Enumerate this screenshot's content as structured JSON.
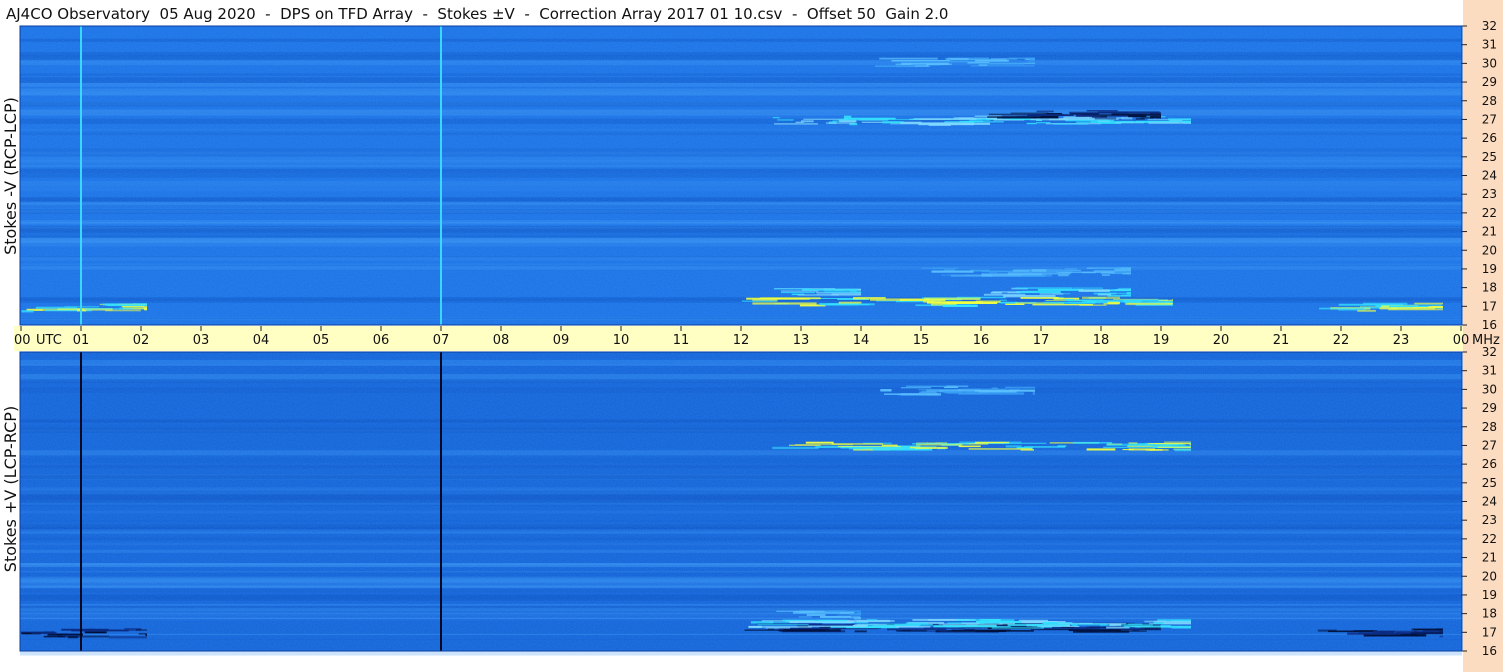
{
  "title": "AJ4CO Observatory  05 Aug 2020  -  DPS on TFD Array  -  Stokes ±V  -  Correction Array 2017 01 10.csv  -  Offset 50  Gain 2.0",
  "colors": {
    "page_bg": "#ffffff",
    "time_strip": "#ffffc4",
    "freq_strip": "#fcdcc0",
    "spec_base_top": "#1f74e6",
    "spec_base_bottom": "#1866da",
    "burst_cyan": "#33e0ff",
    "burst_yellow": "#f0ff40",
    "dark_line": "#00103a"
  },
  "chart_data": [
    {
      "type": "heatmap",
      "name": "Stokes -V (RCP-LCP)",
      "ylabel": "Stokes -V (RCP-LCP)",
      "xlabel_units": "UTC",
      "yunits": "MHz",
      "xlim": [
        0,
        24
      ],
      "ylim": [
        16,
        32
      ],
      "x_ticks": [
        "00",
        "01",
        "02",
        "03",
        "04",
        "05",
        "06",
        "07",
        "08",
        "09",
        "10",
        "11",
        "12",
        "13",
        "14",
        "15",
        "16",
        "17",
        "18",
        "19",
        "20",
        "21",
        "22",
        "23",
        "00"
      ],
      "y_ticks": [
        "16",
        "17",
        "18",
        "19",
        "20",
        "21",
        "22",
        "23",
        "24",
        "25",
        "26",
        "27",
        "28",
        "29",
        "30",
        "31",
        "32"
      ],
      "vertical_markers_utc": [
        1.0,
        7.0
      ],
      "marker_color": "cyan",
      "activity": [
        {
          "start_utc": 0.0,
          "end_utc": 2.1,
          "freq_mhz": 17.0,
          "intensity": "high"
        },
        {
          "start_utc": 12.0,
          "end_utc": 19.2,
          "freq_mhz": 17.3,
          "intensity": "high"
        },
        {
          "start_utc": 12.5,
          "end_utc": 14.0,
          "freq_mhz": 17.8,
          "intensity": "medium"
        },
        {
          "start_utc": 16.0,
          "end_utc": 18.5,
          "freq_mhz": 17.8,
          "intensity": "medium"
        },
        {
          "start_utc": 21.5,
          "end_utc": 23.7,
          "freq_mhz": 17.0,
          "intensity": "high"
        },
        {
          "start_utc": 15.0,
          "end_utc": 18.5,
          "freq_mhz": 18.9,
          "intensity": "low"
        },
        {
          "start_utc": 12.5,
          "end_utc": 19.5,
          "freq_mhz": 27.0,
          "intensity": "medium"
        },
        {
          "start_utc": 14.2,
          "end_utc": 16.9,
          "freq_mhz": 30.1,
          "intensity": "low"
        },
        {
          "start_utc": 16.0,
          "end_utc": 19.0,
          "freq_mhz": 27.3,
          "intensity": "dark"
        }
      ]
    },
    {
      "type": "heatmap",
      "name": "Stokes +V (LCP-RCP)",
      "ylabel": "Stokes +V (LCP-RCP)",
      "xlabel_units": "UTC",
      "yunits": "MHz",
      "xlim": [
        0,
        24
      ],
      "ylim": [
        16,
        32
      ],
      "x_ticks": [
        "00",
        "01",
        "02",
        "03",
        "04",
        "05",
        "06",
        "07",
        "08",
        "09",
        "10",
        "11",
        "12",
        "13",
        "14",
        "15",
        "16",
        "17",
        "18",
        "19",
        "20",
        "21",
        "22",
        "23",
        "00"
      ],
      "y_ticks": [
        "16",
        "17",
        "18",
        "19",
        "20",
        "21",
        "22",
        "23",
        "24",
        "25",
        "26",
        "27",
        "28",
        "29",
        "30",
        "31",
        "32"
      ],
      "vertical_markers_utc": [
        1.0,
        7.0
      ],
      "marker_color": "black",
      "activity": [
        {
          "start_utc": 0.0,
          "end_utc": 2.1,
          "freq_mhz": 17.0,
          "intensity": "dark"
        },
        {
          "start_utc": 12.0,
          "end_utc": 19.0,
          "freq_mhz": 17.3,
          "intensity": "dark"
        },
        {
          "start_utc": 12.0,
          "end_utc": 19.5,
          "freq_mhz": 17.5,
          "intensity": "medium"
        },
        {
          "start_utc": 21.5,
          "end_utc": 23.7,
          "freq_mhz": 17.0,
          "intensity": "dark"
        },
        {
          "start_utc": 12.5,
          "end_utc": 19.5,
          "freq_mhz": 27.0,
          "intensity": "high"
        },
        {
          "start_utc": 14.2,
          "end_utc": 16.9,
          "freq_mhz": 30.0,
          "intensity": "low"
        },
        {
          "start_utc": 12.5,
          "end_utc": 14.0,
          "freq_mhz": 18.0,
          "intensity": "low"
        }
      ]
    }
  ],
  "time_axis": {
    "utc_label": "UTC",
    "mhz_label": "MHz"
  }
}
